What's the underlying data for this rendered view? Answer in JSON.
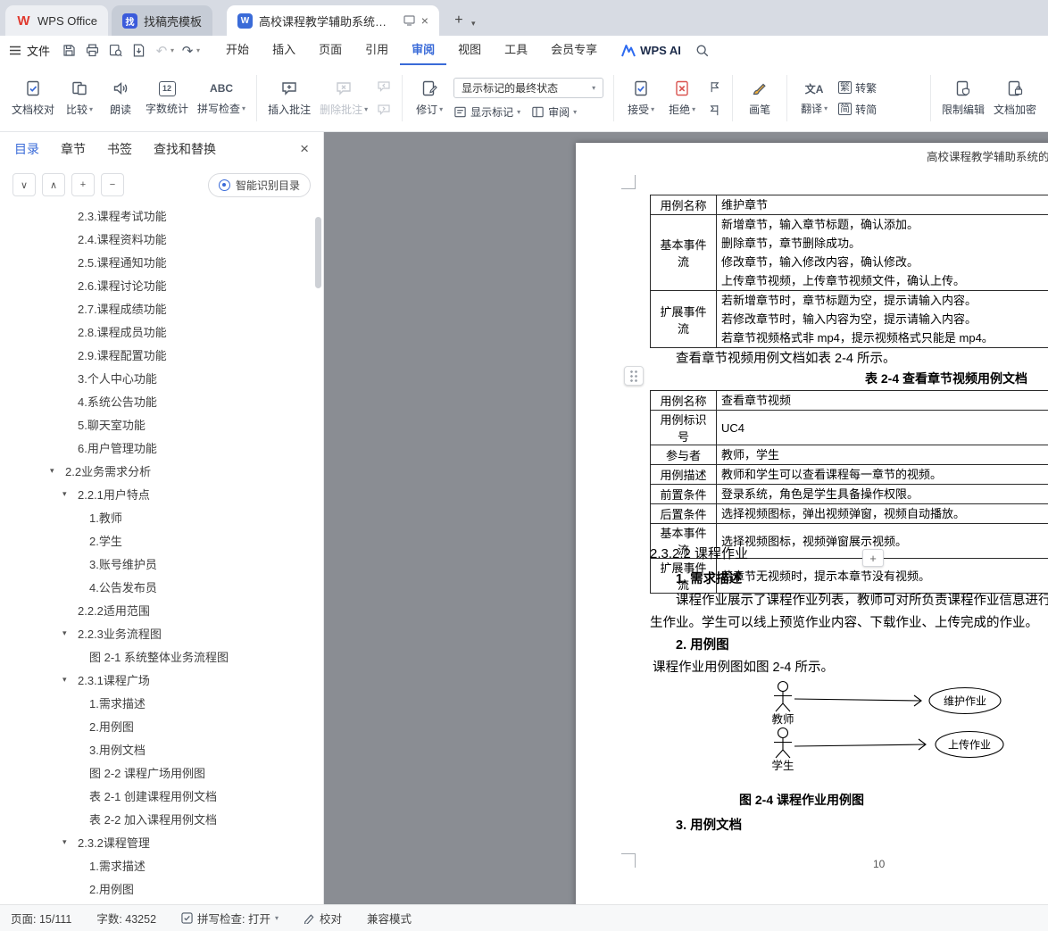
{
  "icons": {
    "caret": "▾",
    "chev_down": "∨",
    "chev_up": "∧",
    "plus": "+",
    "minus": "−",
    "close": "×",
    "undo": "↶",
    "redo": "↷",
    "collapse": "▾",
    "w_red": "W",
    "w_blue": "W",
    "app_glyph": "找",
    "word_count": "12",
    "spell": "ABC",
    "translate": "文A",
    "trad": "繁",
    "simp": "简"
  },
  "tabbar": {
    "home_tab": {
      "label": "WPS Office"
    },
    "app_tab": {
      "label": "找稿壳模板"
    },
    "doc_tab": {
      "label": "高校课程教学辅助系统的设计"
    }
  },
  "menubar": {
    "file_label": "文件",
    "menus": [
      "开始",
      "插入",
      "页面",
      "引用",
      "审阅",
      "视图",
      "工具",
      "会员专享"
    ],
    "ai_label": "WPS AI"
  },
  "ribbon": {
    "doc_proof": "文档校对",
    "compare": "比较",
    "read_aloud": "朗读",
    "word_count": "字数统计",
    "spell_check": "拼写检查",
    "insert_comment": "插入批注",
    "delete_comment": "删除批注",
    "track_changes": "修订",
    "markup_state": "显示标记的最终状态",
    "show_markup": "显示标记",
    "review_pane": "审阅",
    "accept": "接受",
    "reject": "拒绝",
    "brush": "画笔",
    "translate": "翻译",
    "to_traditional": "转繁",
    "to_simplified": "转简",
    "restrict_edit": "限制编辑",
    "encrypt": "文档加密"
  },
  "sidebar": {
    "tabs": [
      "目录",
      "章节",
      "书签",
      "查找和替换"
    ],
    "smart_toc": "智能识别目录",
    "toc": [
      {
        "label": "2.3.课程考试功能",
        "level": 2
      },
      {
        "label": "2.4.课程资料功能",
        "level": 2
      },
      {
        "label": "2.5.课程通知功能",
        "level": 2
      },
      {
        "label": "2.6.课程讨论功能",
        "level": 2
      },
      {
        "label": "2.7.课程成绩功能",
        "level": 2
      },
      {
        "label": "2.8.课程成员功能",
        "level": 2
      },
      {
        "label": "2.9.课程配置功能",
        "level": 2
      },
      {
        "label": "3.个人中心功能",
        "level": 2
      },
      {
        "label": "4.系统公告功能",
        "level": 2
      },
      {
        "label": "5.聊天室功能",
        "level": 2
      },
      {
        "label": "6.用户管理功能",
        "level": 2
      },
      {
        "label": "2.2业务需求分析",
        "level": 1,
        "expanded": true
      },
      {
        "label": "2.2.1用户特点",
        "level": 2,
        "expanded": true
      },
      {
        "label": "1.教师",
        "level": 3
      },
      {
        "label": "2.学生",
        "level": 3
      },
      {
        "label": "3.账号维护员",
        "level": 3
      },
      {
        "label": "4.公告发布员",
        "level": 3
      },
      {
        "label": "2.2.2适用范围",
        "level": 2
      },
      {
        "label": "2.2.3业务流程图",
        "level": 2,
        "expanded": true
      },
      {
        "label": "图 2-1  系统整体业务流程图",
        "level": 3
      },
      {
        "label": "2.3.1课程广场",
        "level": 2,
        "expanded": true
      },
      {
        "label": "1.需求描述",
        "level": 3
      },
      {
        "label": "2.用例图",
        "level": 3
      },
      {
        "label": "3.用例文档",
        "level": 3
      },
      {
        "label": "图 2-2  课程广场用例图",
        "level": 3
      },
      {
        "label": "表 2-1  创建课程用例文档",
        "level": 3
      },
      {
        "label": "表 2-2  加入课程用例文档",
        "level": 3
      },
      {
        "label": "2.3.2课程管理",
        "level": 2,
        "expanded": true
      },
      {
        "label": "1.需求描述",
        "level": 3
      },
      {
        "label": "2.用例图",
        "level": 3
      }
    ]
  },
  "document": {
    "header_text": "高校课程教学辅助系统的",
    "table1": {
      "rows": [
        {
          "label": "用例名称",
          "lines": [
            "维护章节"
          ]
        },
        {
          "label": "基本事件流",
          "lines": [
            "新增章节，输入章节标题，确认添加。",
            "删除章节，章节删除成功。",
            "修改章节，输入修改内容，确认修改。",
            "上传章节视频，上传章节视频文件，确认上传。"
          ]
        },
        {
          "label": "扩展事件流",
          "lines": [
            "若新增章节时，章节标题为空，提示请输入内容。",
            "若修改章节时，输入内容为空，提示请输入内容。",
            "若章节视频格式非 mp4，提示视频格式只能是 mp4。"
          ]
        }
      ]
    },
    "para_lookup": "查看章节视频用例文档如表 2-4 所示。",
    "table2_caption": "表 2-4 查看章节视频用例文档",
    "table2": {
      "rows": [
        {
          "label": "用例名称",
          "lines": [
            "查看章节视频"
          ]
        },
        {
          "label": "用例标识号",
          "lines": [
            "UC4"
          ]
        },
        {
          "label": "参与者",
          "lines": [
            "教师，学生"
          ]
        },
        {
          "label": "用例描述",
          "lines": [
            "教师和学生可以查看课程每一章节的视频。"
          ]
        },
        {
          "label": "前置条件",
          "lines": [
            "登录系统，角色是学生具备操作权限。"
          ]
        },
        {
          "label": "后置条件",
          "lines": [
            "选择视频图标，弹出视频弹窗，视频自动播放。"
          ]
        },
        {
          "label": "基本事件流",
          "lines": [
            "选择视频图标，视频弹窗展示视频。"
          ]
        },
        {
          "label": "扩展事件流",
          "lines": [
            "若章节无视频时，提示本章节没有视频。"
          ]
        }
      ]
    },
    "section_heading": "2.3.2.2 课程作业",
    "req_heading": "1. 需求描述",
    "req_line1": "课程作业展示了课程作业列表，教师可对所负责课程作业信息进行维护",
    "req_line2": "生作业。学生可以线上预览作业内容、下载作业、上传完成的作业。",
    "usecase_heading": "2. 用例图",
    "usecase_para": "课程作业用例图如图 2-4 所示。",
    "diagram": {
      "actors": [
        "教师",
        "学生"
      ],
      "usecases": [
        "维护作业",
        "上传作业"
      ]
    },
    "figure_caption": "图 2-4 课程作业用例图",
    "doc_heading": "3. 用例文档",
    "page_number": "10"
  },
  "statusbar": {
    "page": "页面: 15/111",
    "words": "字数: 43252",
    "spell": "拼写检查: 打开",
    "proof": "校对",
    "compat": "兼容模式"
  }
}
